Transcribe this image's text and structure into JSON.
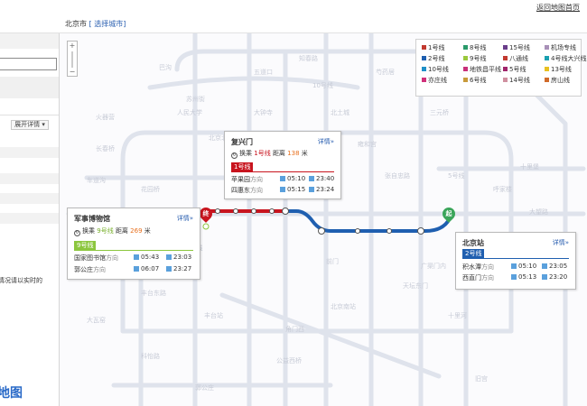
{
  "header": {
    "city": "北京市",
    "select_city": "[ 选择城市]",
    "home_link": "返回地图首页"
  },
  "left_panel": {
    "expand_label": "展开详情",
    "note_text": "情况请以实时的",
    "note_text2": "",
    "big_text": "地图"
  },
  "map": {
    "zoom_plus": "+",
    "zoom_minus": "−"
  },
  "legend": [
    {
      "label": "1号线",
      "color": "#c23a30"
    },
    {
      "label": "8号线",
      "color": "#2a9a6a"
    },
    {
      "label": "15号线",
      "color": "#6a3d8a"
    },
    {
      "label": "机场专线",
      "color": "#a890b8"
    },
    {
      "label": "2号线",
      "color": "#1f5fb0"
    },
    {
      "label": "9号线",
      "color": "#9ac83c"
    },
    {
      "label": "八通线",
      "color": "#c23a30"
    },
    {
      "label": "4号线大兴线",
      "color": "#1aa0b0"
    },
    {
      "label": "10号线",
      "color": "#1f90c8"
    },
    {
      "label": "地铁昌平线",
      "color": "#c8307a"
    },
    {
      "label": "5号线",
      "color": "#a0246a"
    },
    {
      "label": "13号线",
      "color": "#e8c020"
    },
    {
      "label": "亦庄线",
      "color": "#d0307a"
    },
    {
      "label": "6号线",
      "color": "#c89a3a"
    },
    {
      "label": "14号线",
      "color": "#d090a0"
    },
    {
      "label": "房山线",
      "color": "#d06a2a"
    }
  ],
  "cards": {
    "fuxingmen": {
      "title": "复兴门",
      "detail": "详情»",
      "transfer_prefix": "换乘",
      "transfer_line": "1号线",
      "distance_prefix": "距离",
      "distance": "138",
      "unit": "米",
      "line_badge": "1号线",
      "badge_color": "#c8141e",
      "directions": [
        {
          "station": "苹果园",
          "dir": "方向",
          "first": "05:10",
          "last": "23:40"
        },
        {
          "station": "四惠东",
          "dir": "方向",
          "first": "05:15",
          "last": "23:24"
        }
      ]
    },
    "junshi": {
      "title": "军事博物馆",
      "detail": "详情»",
      "transfer_prefix": "换乘",
      "transfer_line": "9号线",
      "distance_prefix": "距离",
      "distance": "269",
      "unit": "米",
      "line_badge": "9号线",
      "badge_color": "#8cc63e",
      "directions": [
        {
          "station": "国家图书馆",
          "dir": "方向",
          "first": "05:43",
          "last": "23:03"
        },
        {
          "station": "郭公庄",
          "dir": "方向",
          "first": "06:07",
          "last": "23:27"
        }
      ]
    },
    "beijingzhan": {
      "title": "北京站",
      "detail": "详情»",
      "line_badge": "2号线",
      "badge_color": "#1f5fb0",
      "directions": [
        {
          "station": "积水潭",
          "dir": "方向",
          "first": "05:10",
          "last": "23:05"
        },
        {
          "station": "西直门",
          "dir": "方向",
          "first": "05:13",
          "last": "23:20"
        }
      ]
    }
  },
  "pins": {
    "end": "终",
    "start": "起"
  }
}
